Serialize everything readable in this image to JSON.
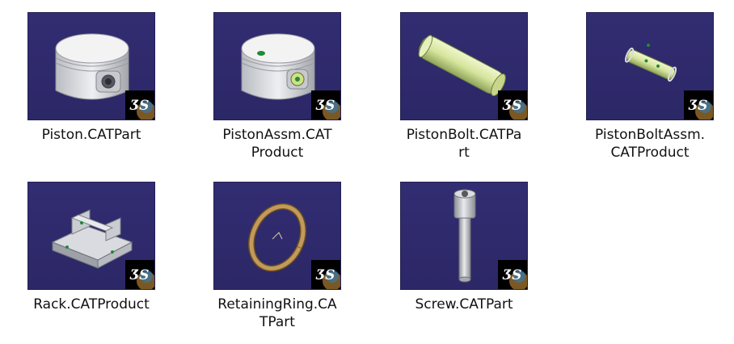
{
  "files": [
    {
      "name": "Piston.CATPart",
      "display": "Piston.CATPart",
      "icon": "piston-model-icon"
    },
    {
      "name": "PistonAssm.CATProduct",
      "display": "PistonAssm.CAT\nProduct",
      "icon": "piston-assembly-model-icon"
    },
    {
      "name": "PistonBolt.CATPart",
      "display": "PistonBolt.CATPa\nrt",
      "icon": "bolt-model-icon"
    },
    {
      "name": "PistonBoltAssm.CATProduct",
      "display": "PistonBoltAssm.\nCATProduct",
      "icon": "bolt-assembly-model-icon"
    },
    {
      "name": "Rack.CATProduct",
      "display": "Rack.CATProduct",
      "icon": "rack-model-icon"
    },
    {
      "name": "RetainingRing.CATPart",
      "display": "RetainingRing.CA\nTPart",
      "icon": "retaining-ring-model-icon"
    },
    {
      "name": "Screw.CATPart",
      "display": "Screw.CATPart",
      "icon": "screw-model-icon"
    }
  ],
  "colors": {
    "thumbnail_background": "#2f2a6b",
    "model_gray": "#d7d9dd",
    "model_green": "#d8e7a4",
    "ring_bronze": "#b08a4e"
  }
}
